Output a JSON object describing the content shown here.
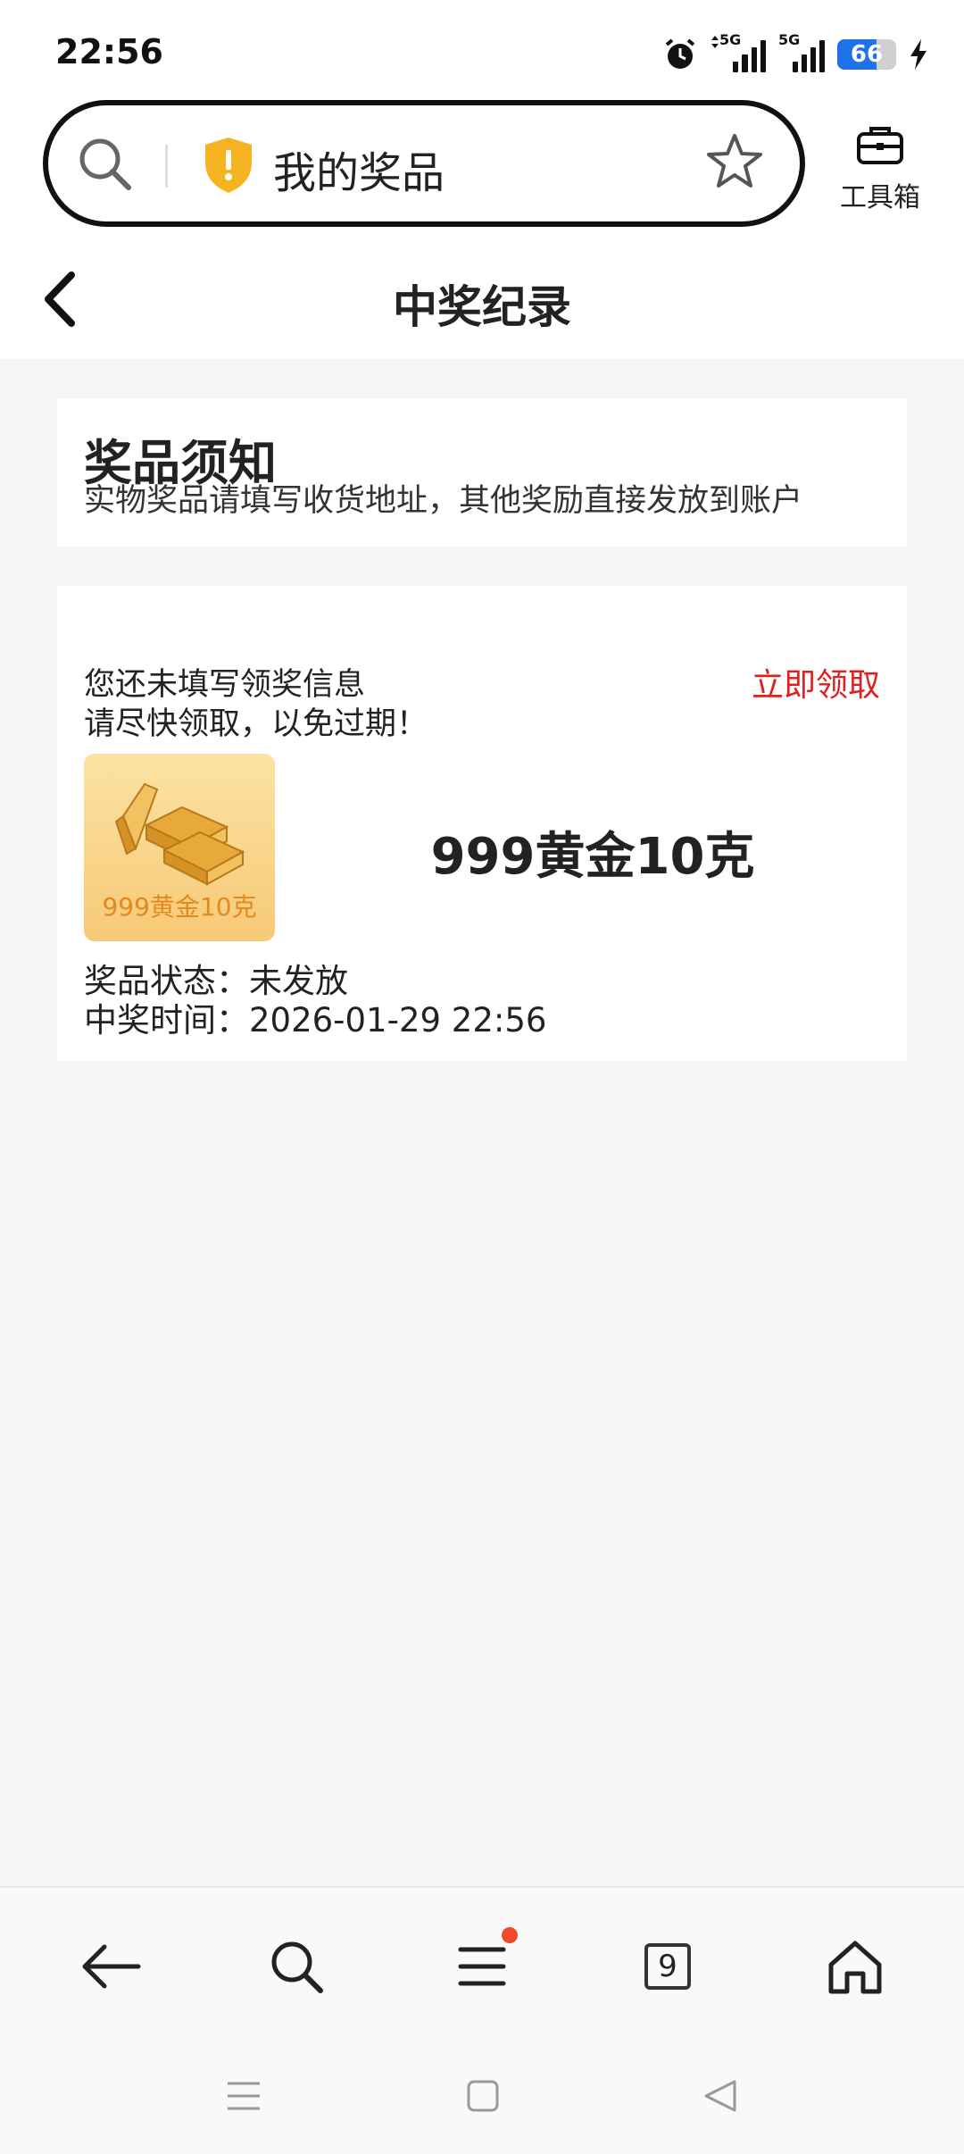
{
  "status_bar": {
    "time": "22:56",
    "network_1": "5G",
    "network_2": "5G",
    "battery": "66",
    "icons": [
      "alarm-icon",
      "signal-icon",
      "signal-icon",
      "battery-icon",
      "charging-icon"
    ]
  },
  "search_bar": {
    "title": "我的奖品",
    "icons": [
      "search-icon",
      "shield-warning-icon",
      "star-icon"
    ]
  },
  "toolbox": {
    "label": "工具箱",
    "icon": "toolbox-icon"
  },
  "header": {
    "title": "中奖纪录",
    "back_icon": "back-chevron-icon"
  },
  "notice": {
    "title": "奖品须知",
    "description": "实物奖品请填写收货地址，其他奖励直接发放到账户"
  },
  "prize_card": {
    "message_line1": "您还未填写领奖信息",
    "message_line2": "请尽快领取，以免过期！",
    "claim_label": "立即领取",
    "thumb_caption": "999黄金10克",
    "prize_name": "999黄金10克",
    "status_label": "奖品状态：",
    "status_value": "未发放",
    "time_label": "中奖时间：",
    "time_value": "2026-01-29 22:56"
  },
  "bottom_nav": {
    "tab_count": "9",
    "icons": [
      "back-arrow-icon",
      "search-icon",
      "menu-icon",
      "tabs-icon",
      "home-icon"
    ]
  },
  "system_nav": {
    "icons": [
      "recents-icon",
      "home-square-icon",
      "back-triangle-icon"
    ]
  },
  "colors": {
    "accent_red": "#e02020",
    "background": "#f5f5f5",
    "card": "#ffffff",
    "gold": "#e28a1e"
  }
}
